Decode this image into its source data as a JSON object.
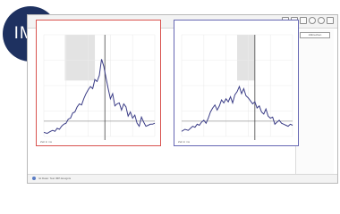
{
  "brand": {
    "badge_text": "IMP",
    "badge_color": "#1e3160"
  },
  "window": {
    "title": "",
    "status_text": "Ist Datei: Test IMP-Ereignis",
    "toolbar_icons": [
      "print-icon",
      "copy-icon",
      "export-icon",
      "settings-icon",
      "help-icon",
      "close-icon"
    ]
  },
  "sidepanel": {
    "button_label": "Abbrechen"
  },
  "panels": [
    {
      "header": "",
      "footer": "Zeit in ms",
      "accent": "#d9534f",
      "shade_color": "#e3e3e3"
    },
    {
      "header": "",
      "footer": "Zeit in ms",
      "accent": "#6567b3",
      "shade_color": "#e3e3e3"
    }
  ],
  "chart_data": [
    {
      "type": "line",
      "xlim": [
        0,
        100
      ],
      "ylim": [
        0,
        100
      ],
      "shade_ranges": [
        [
          19,
          46
        ]
      ],
      "vertical_marker_x": 55,
      "series": [
        {
          "color": "#3b3d87",
          "x": [
            0,
            3,
            6,
            8,
            10,
            12,
            14,
            16,
            18,
            20,
            22,
            24,
            26,
            28,
            30,
            32,
            34,
            36,
            38,
            40,
            42,
            44,
            46,
            48,
            50,
            52,
            54,
            56,
            58,
            60,
            62,
            64,
            66,
            68,
            70,
            72,
            74,
            76,
            78,
            80,
            82,
            84,
            86,
            88,
            90,
            92,
            94,
            96,
            98,
            100
          ],
          "y": [
            4,
            3,
            5,
            6,
            5,
            8,
            7,
            10,
            12,
            13,
            17,
            18,
            23,
            24,
            29,
            32,
            31,
            37,
            42,
            46,
            49,
            47,
            56,
            54,
            60,
            76,
            69,
            58,
            47,
            37,
            42,
            30,
            32,
            33,
            26,
            32,
            29,
            20,
            24,
            18,
            21,
            13,
            10,
            19,
            14,
            10,
            11,
            12,
            12,
            13
          ]
        }
      ]
    },
    {
      "type": "line",
      "xlim": [
        0,
        100
      ],
      "ylim": [
        0,
        100
      ],
      "shade_ranges": [
        [
          50,
          66
        ]
      ],
      "vertical_marker_x": 66,
      "series": [
        {
          "color": "#3b3d87",
          "x": [
            0,
            3,
            6,
            8,
            10,
            12,
            14,
            16,
            18,
            20,
            22,
            24,
            26,
            28,
            30,
            32,
            34,
            36,
            38,
            40,
            42,
            44,
            46,
            48,
            50,
            52,
            54,
            56,
            58,
            60,
            62,
            64,
            66,
            68,
            70,
            72,
            74,
            76,
            78,
            80,
            82,
            84,
            86,
            88,
            90,
            92,
            94,
            96,
            98,
            100
          ],
          "y": [
            5,
            7,
            6,
            8,
            10,
            9,
            12,
            11,
            14,
            16,
            13,
            18,
            24,
            28,
            31,
            26,
            30,
            36,
            33,
            37,
            34,
            39,
            33,
            41,
            44,
            49,
            42,
            47,
            40,
            38,
            35,
            32,
            34,
            28,
            30,
            24,
            22,
            27,
            20,
            18,
            19,
            12,
            14,
            16,
            13,
            12,
            11,
            10,
            12,
            11
          ]
        }
      ]
    }
  ]
}
